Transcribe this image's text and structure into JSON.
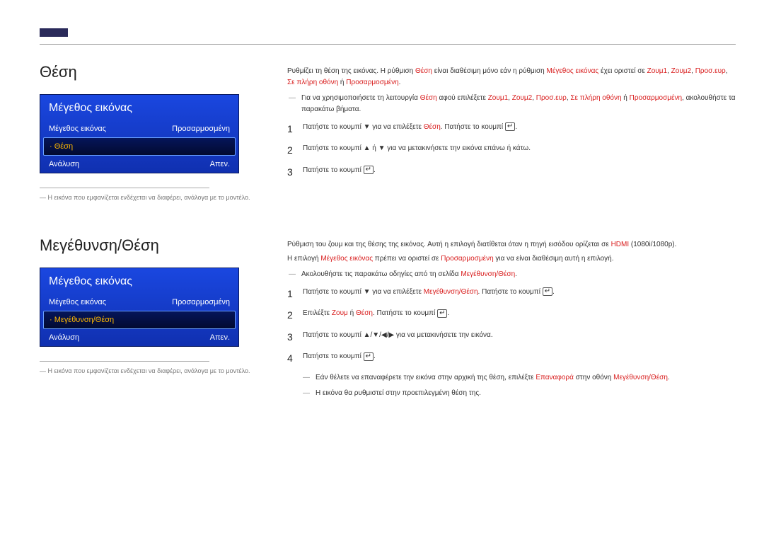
{
  "section1": {
    "heading": "Θέση",
    "menu": {
      "title": "Μέγεθος εικόνας",
      "row1_label": "Μέγεθος εικόνας",
      "row1_value": "Προσαρμοσμένη",
      "row2_label": "· Θέση",
      "row3_label": "Ανάλυση",
      "row3_value": "Απεν."
    },
    "disclaimer": "Η εικόνα που εμφανίζεται ενδέχεται να διαφέρει, ανάλογα με το μοντέλο.",
    "para1_a": "Ρυθμίζει τη θέση της εικόνας. Η ρύθμιση ",
    "para1_b": "Θέση",
    "para1_c": " είναι διαθέσιμη μόνο εάν η ρύθμιση ",
    "para1_d": "Μέγεθος εικόνας",
    "para1_e": " έχει οριστεί σε ",
    "para1_f": "Ζουμ1",
    "para1_g": ", ",
    "para1_h": "Ζουμ2",
    "para1_i": ", ",
    "para1_j": "Προσ.ευρ",
    "para1_k": ", ",
    "para1_l": "Σε πλήρη οθόνη",
    "para1_m": " ή ",
    "para1_n": "Προσαρμοσμένη",
    "para1_o": ".",
    "sub1_a": "Για να χρησιμοποιήσετε τη λειτουργία ",
    "sub1_b": "Θέση",
    "sub1_c": " αφού επιλέξετε ",
    "sub1_d": "Ζουμ1",
    "sub1_e": ", ",
    "sub1_f": "Ζουμ2",
    "sub1_g": ", ",
    "sub1_h": "Προσ.ευρ",
    "sub1_i": ", ",
    "sub1_j": "Σε πλήρη οθόνη",
    "sub1_k": " ή ",
    "sub1_l": "Προσαρμοσμένη",
    "sub1_m": ", ακολουθήστε τα παρακάτω βήματα.",
    "step1_a": "Πατήστε το κουμπί ▼ για να επιλέξετε ",
    "step1_b": "Θέση",
    "step1_c": ". Πατήστε το κουμπί ",
    "step1_d": ".",
    "step2": "Πατήστε το κουμπί ▲ ή ▼ για να μετακινήσετε την εικόνα επάνω ή κάτω.",
    "step3_a": "Πατήστε το κουμπί ",
    "step3_b": "."
  },
  "section2": {
    "heading": "Μεγέθυνση/Θέση",
    "menu": {
      "title": "Μέγεθος εικόνας",
      "row1_label": "Μέγεθος εικόνας",
      "row1_value": "Προσαρμοσμένη",
      "row2_label": "· Μεγέθυνση/Θέση",
      "row3_label": "Ανάλυση",
      "row3_value": "Απεν."
    },
    "disclaimer": "Η εικόνα που εμφανίζεται ενδέχεται να διαφέρει, ανάλογα με το μοντέλο.",
    "para1_a": "Ρύθμιση του ζουμ και της θέσης της εικόνας. Αυτή η επιλογή διατίθεται όταν η πηγή εισόδου ορίζεται σε ",
    "para1_b": "HDMI",
    "para1_c": " (1080i/1080p).",
    "para2_a": "Η επιλογή ",
    "para2_b": "Μέγεθος εικόνας",
    "para2_c": " πρέπει να οριστεί σε ",
    "para2_d": "Προσαρμοσμένη",
    "para2_e": " για να είναι διαθέσιμη αυτή η επιλογή.",
    "sub1_a": "Ακολουθήστε τις παρακάτω οδηγίες από τη σελίδα ",
    "sub1_b": "Μεγέθυνση/Θέση",
    "sub1_c": ".",
    "step1_a": "Πατήστε το κουμπί ▼ για να επιλέξετε ",
    "step1_b": "Μεγέθυνση/Θέση",
    "step1_c": ". Πατήστε το κουμπί ",
    "step1_d": ".",
    "step2_a": "Επιλέξτε ",
    "step2_b": "Ζουμ",
    "step2_c": " ή ",
    "step2_d": "Θέση",
    "step2_e": ". Πατήστε το κουμπί ",
    "step2_f": ".",
    "step3": "Πατήστε το κουμπί ▲/▼/◀/▶ για να μετακινήσετε την εικόνα.",
    "step4_a": "Πατήστε το κουμπί ",
    "step4_b": ".",
    "sub2_a": "Εάν θέλετε να επαναφέρετε την εικόνα στην αρχική της θέση, επιλέξτε ",
    "sub2_b": "Επαναφορά",
    "sub2_c": " στην οθόνη ",
    "sub2_d": "Μεγέθυνση/Θέση",
    "sub2_e": ".",
    "sub3": "Η εικόνα θα ρυθμιστεί στην προεπιλεγμένη θέση της."
  },
  "nums": {
    "n1": "1",
    "n2": "2",
    "n3": "3",
    "n4": "4"
  },
  "enter": "↵"
}
